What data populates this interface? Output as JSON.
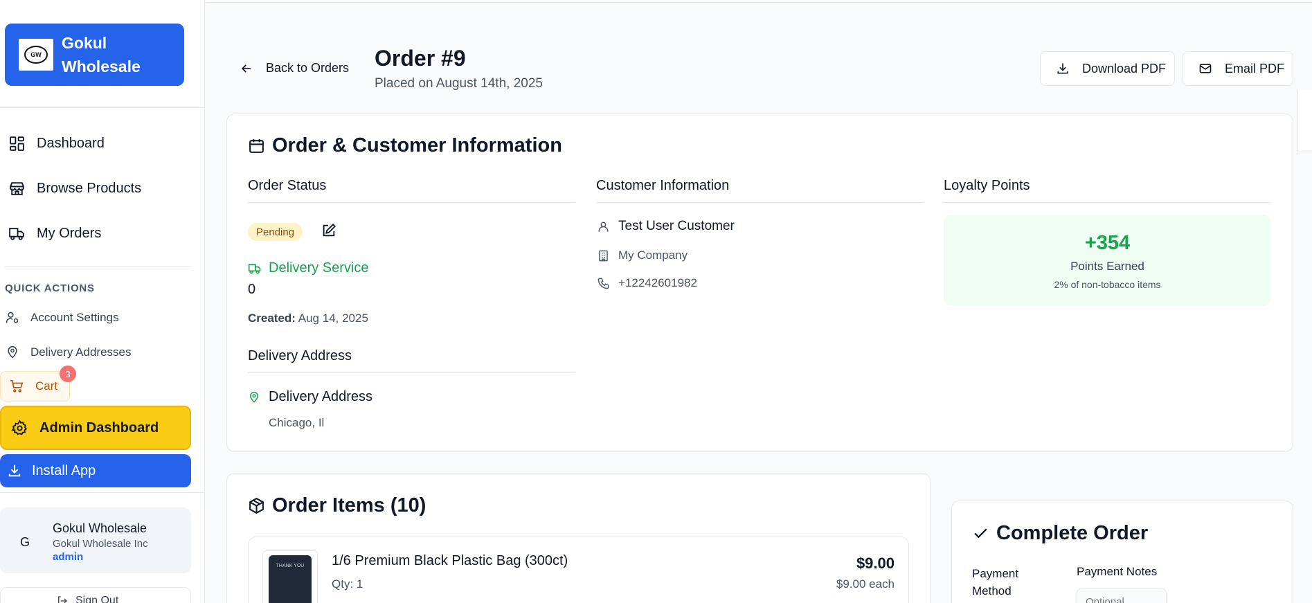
{
  "brand": {
    "logo_text": "GW",
    "name": "Gokul Wholesale"
  },
  "nav": {
    "items": [
      {
        "label": "Dashboard",
        "icon": "dashboard-icon"
      },
      {
        "label": "Browse Products",
        "icon": "store-icon"
      },
      {
        "label": "My Orders",
        "icon": "truck-icon"
      }
    ]
  },
  "quick_actions": {
    "title": "QUICK ACTIONS",
    "items": [
      {
        "label": "Account Settings",
        "icon": "user-settings-icon"
      },
      {
        "label": "Delivery Addresses",
        "icon": "map-pin-icon"
      }
    ],
    "cart": {
      "label": "Cart",
      "badge": "3"
    },
    "admin_label": "Admin Dashboard",
    "install_label": "Install App"
  },
  "user": {
    "initial": "G",
    "name": "Gokul Wholesale",
    "company": "Gokul Wholesale Inc",
    "role": "admin"
  },
  "signout_label": "Sign Out",
  "header": {
    "back_label": "Back to Orders",
    "title": "Order #9",
    "placed": "Placed on August 14th, 2025",
    "download_label": "Download PDF",
    "email_label": "Email PDF"
  },
  "info_card": {
    "title": "Order & Customer Information",
    "order_status_heading": "Order Status",
    "status": "Pending",
    "delivery_service_label": "Delivery Service",
    "delivery_service_value": "0",
    "created_label": "Created:",
    "created_value": "Aug 14, 2025",
    "delivery_address_heading": "Delivery Address",
    "delivery_address_label": "Delivery Address",
    "delivery_address_city": "Chicago, Il",
    "customer_heading": "Customer Information",
    "customer_name": "Test User Customer",
    "customer_company": "My Company",
    "customer_phone": "+12242601982",
    "loyalty_heading": "Loyalty Points",
    "loyalty_points": "+354",
    "loyalty_label": "Points Earned",
    "loyalty_sub": "2% of non-tobacco items"
  },
  "items_card": {
    "title": "Order Items (10)",
    "items": [
      {
        "name": "1/6 Premium Black Plastic Bag (300ct)",
        "qty": "Qty: 1",
        "price": "$9.00",
        "each": "$9.00 each",
        "thumb_text": "THANK YOU"
      }
    ]
  },
  "complete_card": {
    "title": "Complete Order",
    "payment_method_label": "Payment Method",
    "payment_notes_label": "Payment Notes",
    "payment_notes_placeholder": "Optional..."
  },
  "colors": {
    "primary": "#2563eb",
    "admin": "#facc15",
    "success": "#16a34a",
    "pending_bg": "#fef3c7",
    "cart_badge": "#f87171"
  }
}
